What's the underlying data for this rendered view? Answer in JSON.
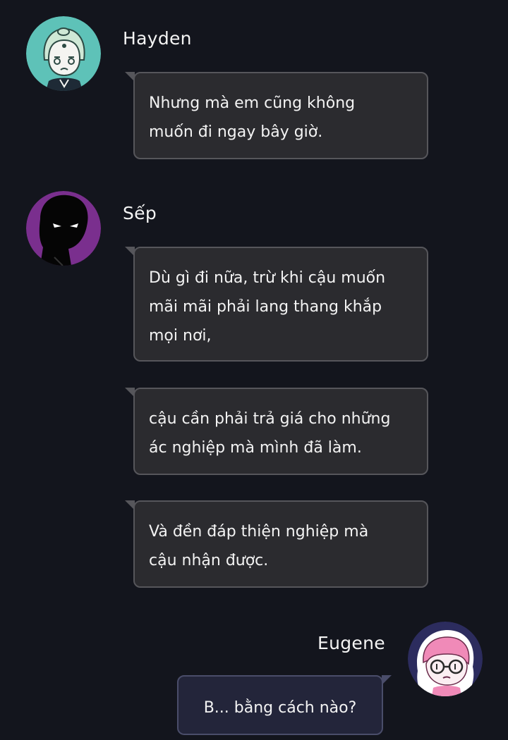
{
  "messages": [
    {
      "sender": "Hayden",
      "lines": [
        "Nhưng mà em cũng không",
        "muốn đi ngay bây giờ."
      ]
    },
    {
      "sender": "Sếp",
      "lines": [
        "Dù gì đi nữa, trừ khi cậu muốn",
        "mãi mãi phải lang thang khắp",
        "mọi nơi,"
      ]
    },
    {
      "lines": [
        "cậu cần phải trả giá cho những",
        "ác nghiệp mà mình đã làm."
      ]
    },
    {
      "lines": [
        "Và đền đáp thiện nghiệp mà",
        "cậu nhận được."
      ]
    },
    {
      "sender": "Eugene",
      "lines": [
        "B... bằng cách nào?"
      ]
    }
  ],
  "colors": {
    "background": "#13151d",
    "bubble": "#2b2b2f",
    "bubble_border": "#56565b",
    "my_bubble": "#23253a",
    "hayden_avatar": "#5ec2b8",
    "boss_avatar": "#7a2f8e",
    "eugene_avatar": "#2c2c5e"
  }
}
